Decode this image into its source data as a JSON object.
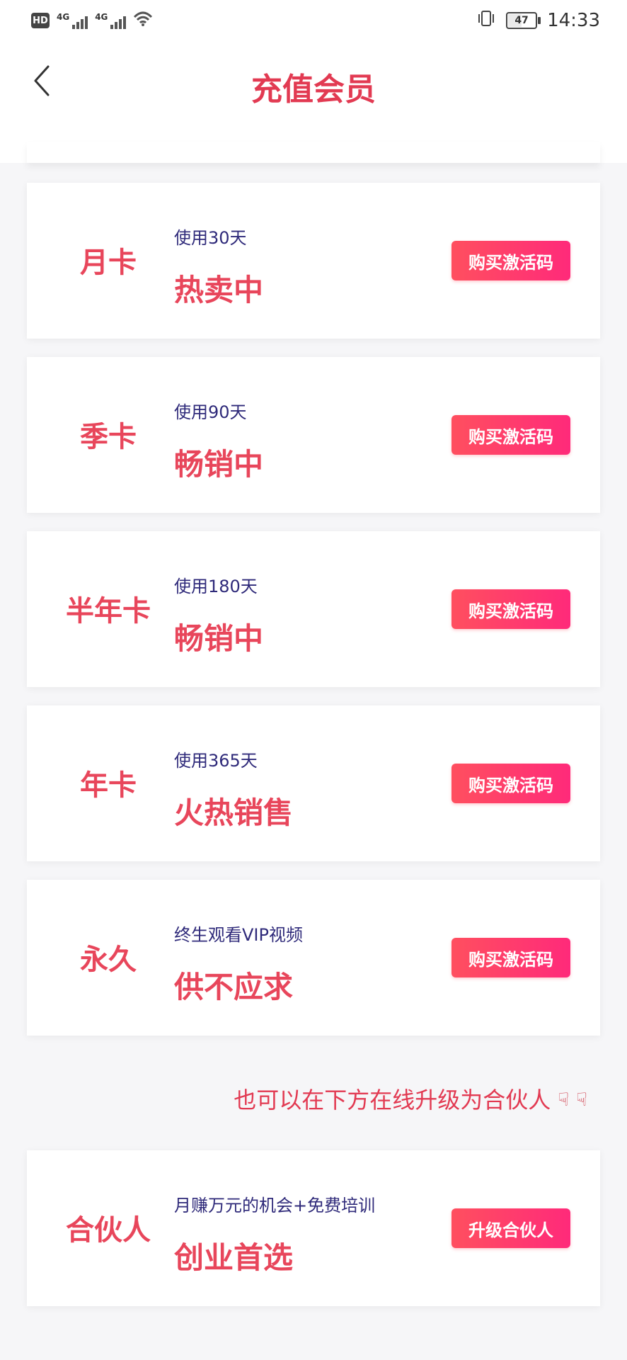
{
  "status_bar": {
    "hd": "HD",
    "sim1_label": "4G",
    "sim2_label": "4G",
    "battery": "47",
    "time": "14:33",
    "icons": [
      "hd-icon",
      "signal-icon",
      "signal-icon",
      "wifi-icon",
      "vibrate-icon",
      "battery-icon"
    ]
  },
  "nav": {
    "title": "充值会员",
    "back_icon": "chevron-left-icon"
  },
  "plans": [
    {
      "name": "月卡",
      "subtitle": "使用30天",
      "status": "热卖中",
      "button": "购买激活码"
    },
    {
      "name": "季卡",
      "subtitle": "使用90天",
      "status": "畅销中",
      "button": "购买激活码"
    },
    {
      "name": "半年卡",
      "subtitle": "使用180天",
      "status": "畅销中",
      "button": "购买激活码"
    },
    {
      "name": "年卡",
      "subtitle": "使用365天",
      "status": "火热销售",
      "button": "购买激活码"
    },
    {
      "name": "永久",
      "subtitle": "终生观看VIP视频",
      "status": "供不应求",
      "button": "购买激活码"
    }
  ],
  "promo": {
    "text": "也可以在下方在线升级为合伙人",
    "icons": [
      "pointing-down-icon",
      "pointing-down-icon"
    ]
  },
  "partner": {
    "name": "合伙人",
    "subtitle": "月赚万元的机会+免费培训",
    "status": "创业首选",
    "button": "升级合伙人"
  },
  "colors": {
    "accent": "#e8465b",
    "subtitle": "#2f2a7a",
    "button_from": "#ff4f5f",
    "button_to": "#ff2a7a"
  }
}
